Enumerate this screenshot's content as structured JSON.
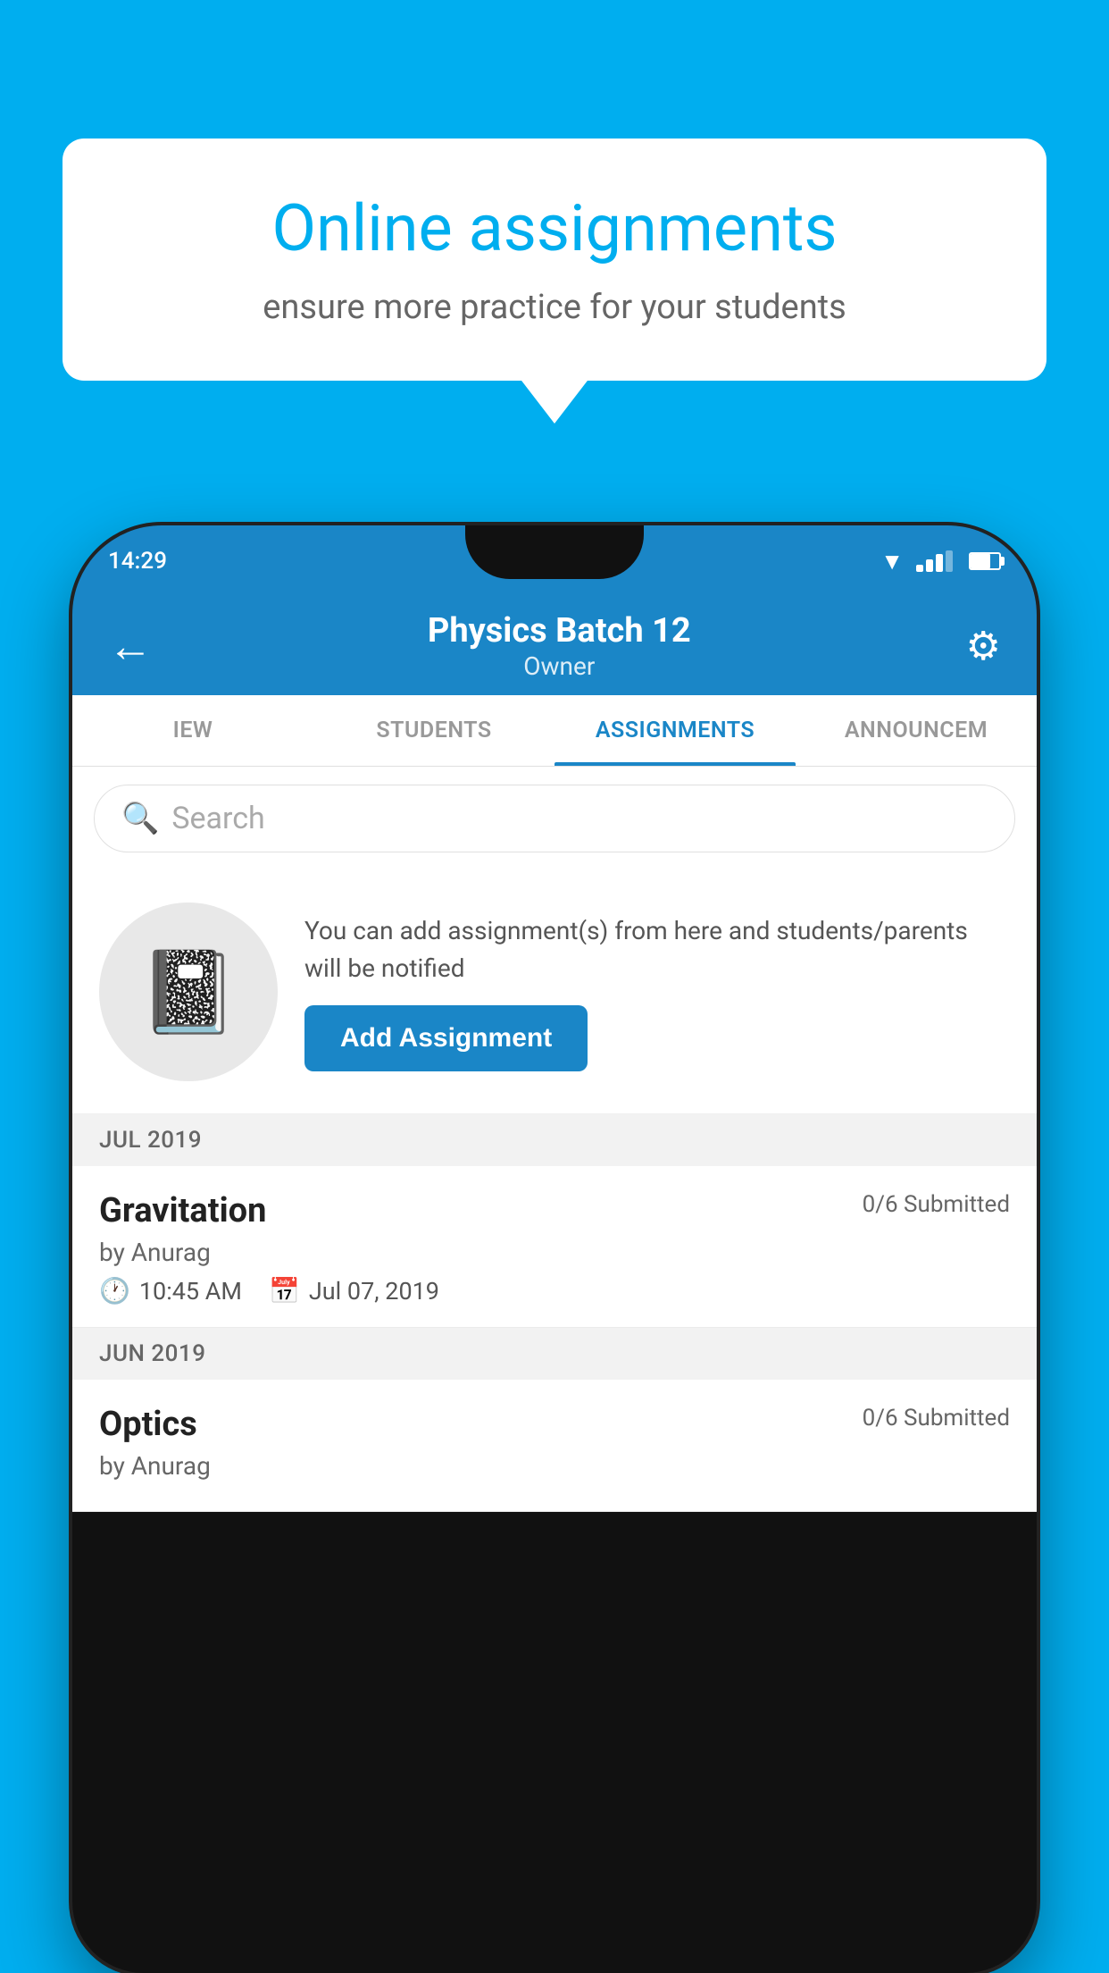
{
  "background_color": "#00AEEF",
  "speech_bubble": {
    "title": "Online assignments",
    "subtitle": "ensure more practice for your students"
  },
  "status_bar": {
    "time": "14:29"
  },
  "toolbar": {
    "title": "Physics Batch 12",
    "subtitle": "Owner",
    "back_label": "←",
    "settings_label": "⚙"
  },
  "tabs": [
    {
      "label": "IEW",
      "active": false
    },
    {
      "label": "STUDENTS",
      "active": false
    },
    {
      "label": "ASSIGNMENTS",
      "active": true
    },
    {
      "label": "ANNOUNCEM",
      "active": false
    }
  ],
  "search": {
    "placeholder": "Search"
  },
  "info_section": {
    "text": "You can add assignment(s) from here and students/parents will be notified",
    "add_button_label": "Add Assignment"
  },
  "sections": [
    {
      "header": "JUL 2019",
      "assignments": [
        {
          "name": "Gravitation",
          "status": "0/6 Submitted",
          "by": "by Anurag",
          "time": "10:45 AM",
          "date": "Jul 07, 2019"
        }
      ]
    },
    {
      "header": "JUN 2019",
      "assignments": [
        {
          "name": "Optics",
          "status": "0/6 Submitted",
          "by": "by Anurag",
          "time": "",
          "date": ""
        }
      ]
    }
  ]
}
